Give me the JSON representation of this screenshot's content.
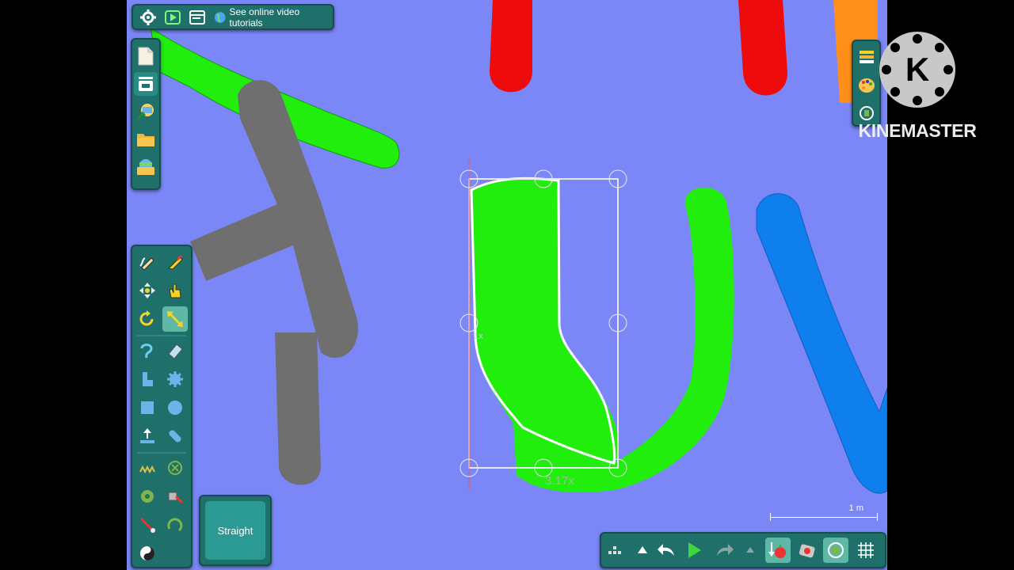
{
  "topbar": {
    "settings_icon": "gear-icon",
    "play_icon": "play-icon",
    "window_icon": "window-icon",
    "tutorial_label": "See online video tutorials",
    "tutorial_icon": "globe-icon"
  },
  "left_panel": {
    "items": [
      "new-document-icon",
      "stack-icon",
      "search-pictures-icon",
      "folder-icon",
      "open-scene-icon"
    ]
  },
  "tools": {
    "items": [
      "pencil-icon",
      "knife-icon",
      "move-icon",
      "hand-icon",
      "rotate-icon",
      "scale-icon",
      "spiral-pen-icon",
      "eraser-icon",
      "boot-icon",
      "gear-spikes-icon",
      "box-icon",
      "circle-icon",
      "fixate-icon",
      "capsule-icon",
      "spring-icon",
      "x-circle-icon",
      "thruster-icon",
      "laser-icon",
      "rope-icon",
      "hinge-icon",
      "spin-icon"
    ],
    "active": "scale-icon"
  },
  "straight_button": {
    "label": "Straight"
  },
  "right_panel": {
    "items": [
      "layers-icon",
      "palette-icon",
      "add-icon"
    ]
  },
  "bottombar": {
    "items": [
      "grid-menu-icon",
      "triangle-up-icon",
      "undo-icon",
      "play-icon",
      "redo-icon",
      "triangle-up-small-icon",
      "gravity-icon",
      "camera-lock-icon",
      "follow-icon",
      "grid-icon"
    ]
  },
  "scale_indicator": {
    "label": "1 m"
  },
  "canvas": {
    "scale_readout": "3.17x",
    "angle_readout": "1x"
  },
  "watermark": {
    "text": "KINEMASTER"
  },
  "colors": {
    "background": "#7b87f7",
    "panel": "#1f6f6b",
    "green": "#22ee0e",
    "gray": "#6f6f6f",
    "red": "#ee0b0b",
    "blue": "#0f7fee",
    "orange": "#ff8f1a"
  }
}
